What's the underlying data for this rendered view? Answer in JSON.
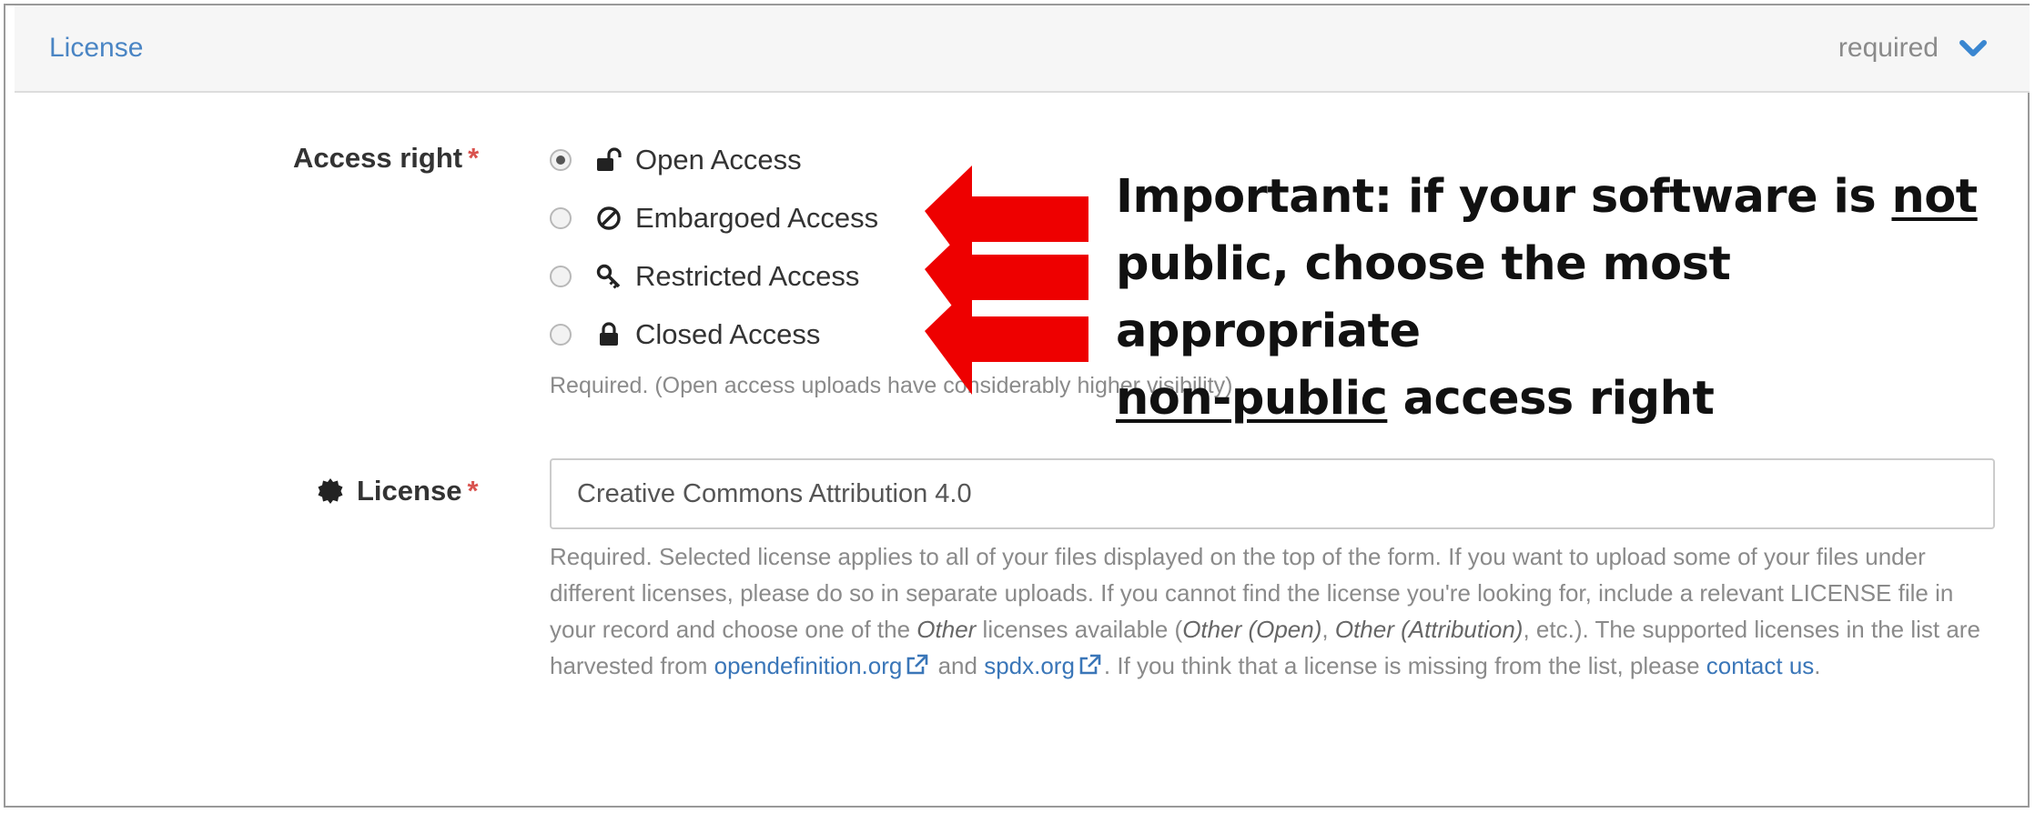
{
  "panel": {
    "title": "License",
    "required_label": "required",
    "chevron_icon": "chevron-down-icon"
  },
  "access_right": {
    "label": "Access right",
    "required_mark": "*",
    "options": [
      {
        "label": "Open Access",
        "icon": "unlock-icon",
        "selected": true
      },
      {
        "label": "Embargoed Access",
        "icon": "ban-icon",
        "selected": false
      },
      {
        "label": "Restricted Access",
        "icon": "key-icon",
        "selected": false
      },
      {
        "label": "Closed Access",
        "icon": "lock-icon",
        "selected": false
      }
    ],
    "help": "Required. (Open access uploads have considerably higher visibility)"
  },
  "license": {
    "label": "License",
    "label_icon": "certificate-icon",
    "required_mark": "*",
    "value": "Creative Commons Attribution 4.0",
    "help": {
      "part1": "Required. Selected license applies to all of your files displayed on the top of the form. If you want to upload some of your files under different licenses, please do so in separate uploads. If you cannot find the license you're looking for, include a relevant LICENSE file in your record and choose one of the ",
      "other": "Other",
      "part2": " licenses available (",
      "other_open": "Other (Open)",
      "sep": ", ",
      "other_attribution": "Other (Attribution)",
      "part3": ", etc.). The supported licenses in the list are harvested from ",
      "link1": "opendefinition.org",
      "and": " and ",
      "link2": "spdx.org",
      "part4": ". If you think that a license is missing from the list, please ",
      "contact": "contact us",
      "end": "."
    }
  },
  "annotation": {
    "line1_prefix": "Important: if your software is ",
    "line1_underlined": "not",
    "line2": "public, choose the most appropriate",
    "line3_underlined": "non-public",
    "line3_suffix": " access right",
    "arrow_color": "#ee0000"
  }
}
